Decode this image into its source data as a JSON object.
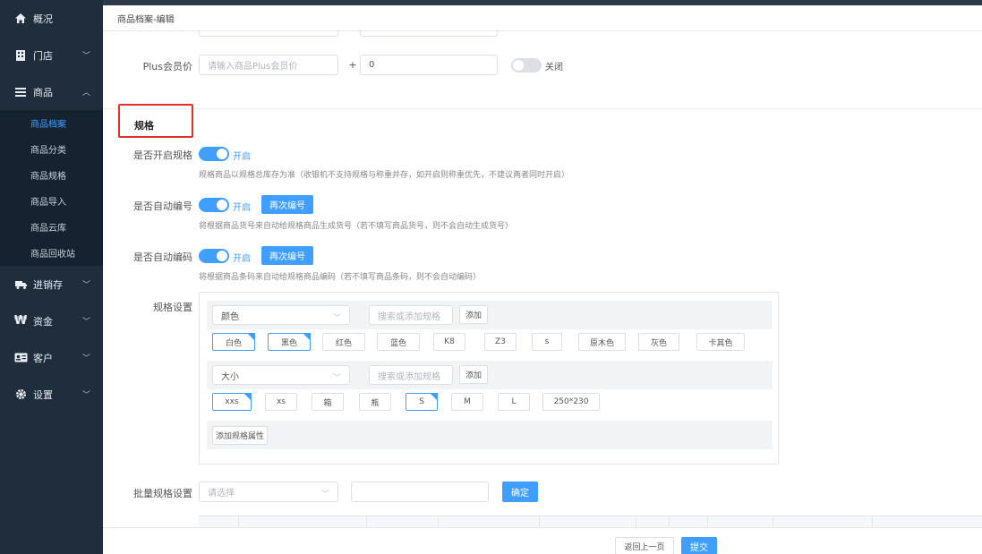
{
  "breadcrumb": "商品档案-编辑",
  "sidebar": {
    "items": [
      {
        "label": "概况",
        "icon": "home-icon"
      },
      {
        "label": "门店",
        "icon": "store-icon"
      },
      {
        "label": "商品",
        "icon": "list-icon"
      },
      {
        "label": "进销存",
        "icon": "truck-icon"
      },
      {
        "label": "资金",
        "icon": "currency-icon"
      },
      {
        "label": "客户",
        "icon": "id-card-icon"
      },
      {
        "label": "设置",
        "icon": "gear-icon"
      }
    ],
    "submenu": [
      "商品档案",
      "商品分类",
      "商品规格",
      "商品导入",
      "商品云库",
      "商品回收站"
    ]
  },
  "plus": {
    "label": "Plus会员价",
    "placeholder": "请输入商品Plus会员价",
    "plus_sign": "+",
    "value": "0",
    "toggle_text": "关闭"
  },
  "spec_section": {
    "title": "规格",
    "enable": {
      "label": "是否开启规格",
      "toggle_text": "开启",
      "hint": "规格商品以规格总库存为准（收银机不支持规格与称重并存，如开启则称重优先，不建议两者同时开启）"
    },
    "auto_number": {
      "label": "是否自动编号",
      "toggle_text": "开启",
      "button": "再次编号",
      "hint": "将根据商品货号来自动给规格商品生成货号（若不填写商品货号，则不会自动生成货号）"
    },
    "auto_code": {
      "label": "是否自动编码",
      "toggle_text": "开启",
      "button": "再次编号",
      "hint": "将根据商品条码来自动给规格商品编码（若不填写商品条码，则不会自动编码）"
    },
    "settings_label": "规格设置",
    "groups": [
      {
        "name": "颜色",
        "search_placeholder": "搜索或添加规格",
        "add": "添加",
        "values": [
          "白色",
          "黑色",
          "红色",
          "蓝色",
          "K8",
          "Z3",
          "s",
          "原木色",
          "灰色",
          "卡其色"
        ]
      },
      {
        "name": "大小",
        "search_placeholder": "搜索或添加规格",
        "add": "添加",
        "values": [
          "xxs",
          "xs",
          "箱",
          "瓶",
          "S",
          "M",
          "L",
          "250*230"
        ]
      }
    ],
    "add_attr": "添加规格属性"
  },
  "batch": {
    "label": "批量规格设置",
    "placeholder": "请选择",
    "confirm": "确定"
  },
  "footer": {
    "back": "返回上一页",
    "submit": "提交"
  }
}
